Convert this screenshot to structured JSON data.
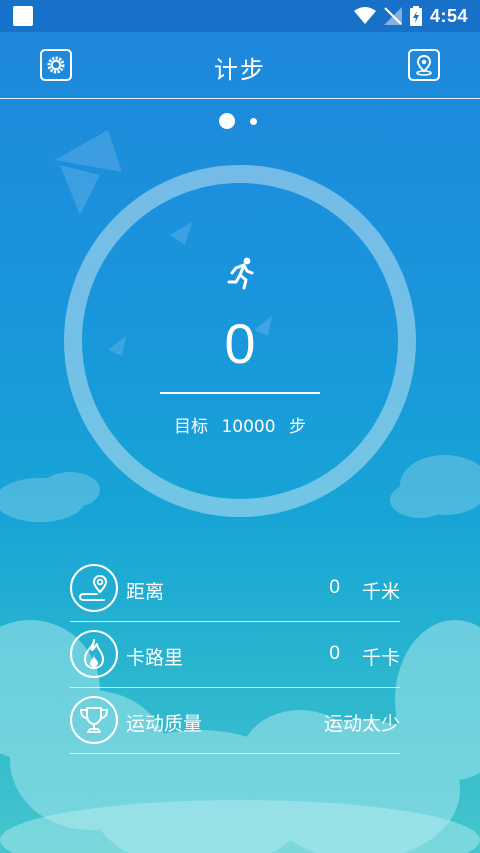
{
  "status_bar": {
    "time": "4:54"
  },
  "header": {
    "title": "计步"
  },
  "pager": {
    "count": 2,
    "active_index": 0
  },
  "pedometer": {
    "steps": "0",
    "goal_label": "目标",
    "goal_value": "10000",
    "goal_unit": "步"
  },
  "stats": {
    "distance": {
      "label": "距离",
      "value": "0",
      "unit": "千米"
    },
    "calories": {
      "label": "卡路里",
      "value": "0",
      "unit": "千卡"
    },
    "quality": {
      "label": "运动质量",
      "value": "运动太少"
    }
  },
  "icons": {
    "header_left": "gear-icon",
    "header_right": "map-pin-icon",
    "runner": "running-man-icon",
    "distance": "map-pin-icon",
    "calories": "flame-icon",
    "quality": "trophy-icon"
  },
  "colors": {
    "status_bar": "#1871c8",
    "background_top": "#1f86dc",
    "background_bottom": "#45c6cc",
    "ring": "#bee1f0",
    "foreground": "#ffffff"
  }
}
